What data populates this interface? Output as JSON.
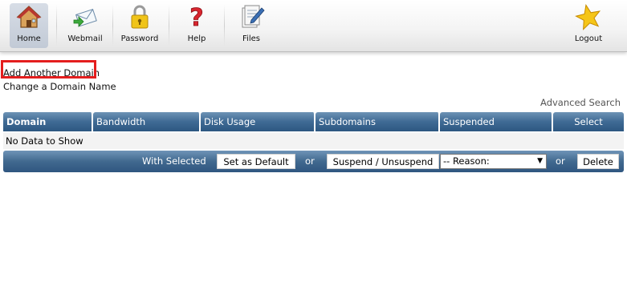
{
  "toolbar": {
    "items": [
      {
        "label": "Home",
        "icon": "home-icon"
      },
      {
        "label": "Webmail",
        "icon": "webmail-icon"
      },
      {
        "label": "Password",
        "icon": "lock-icon"
      },
      {
        "label": "Help",
        "icon": "question-icon"
      },
      {
        "label": "Files",
        "icon": "files-icon"
      },
      {
        "label": "Logout",
        "icon": "star-icon"
      }
    ]
  },
  "links": {
    "add_domain": "Add Another Domain",
    "change_domain": "Change a Domain Name",
    "advanced_search": "Advanced Search"
  },
  "table": {
    "headers": [
      "Domain",
      "Bandwidth",
      "Disk Usage",
      "Subdomains",
      "Suspended",
      "Select"
    ],
    "empty_text": "No Data to Show"
  },
  "actions": {
    "with_selected": "With Selected",
    "set_default": "Set as Default",
    "or1": "or",
    "suspend": "Suspend / Unsuspend",
    "reason_selected": "-- Reason:",
    "or2": "or",
    "delete": "Delete"
  },
  "colors": {
    "header_bar": "#3f6a94",
    "highlight": "#e41e1e"
  }
}
